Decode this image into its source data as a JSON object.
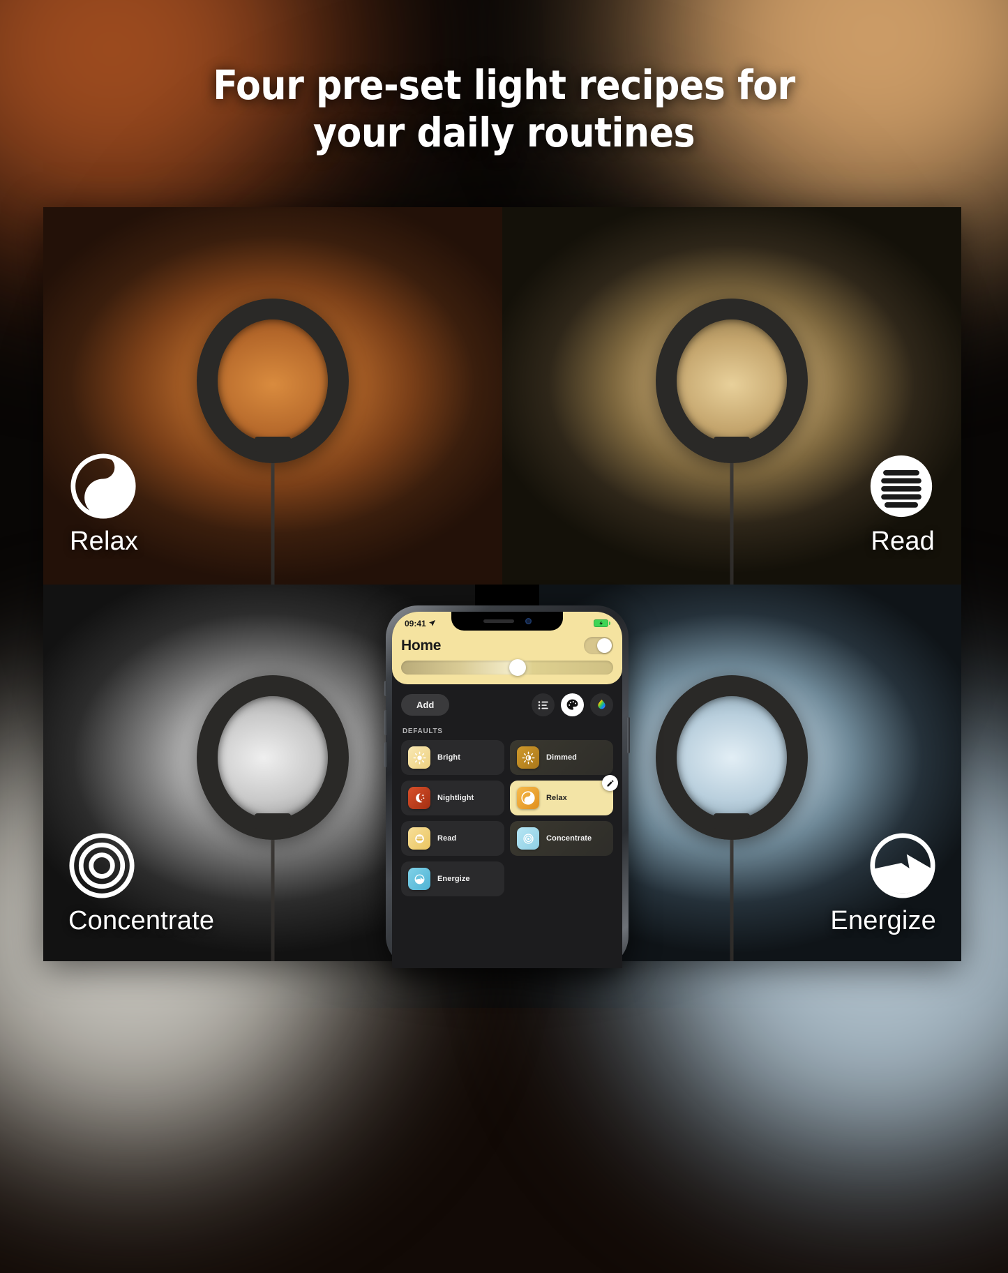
{
  "headline": {
    "line1": "Four pre-set light recipes for",
    "line2": "your daily routines"
  },
  "quadrants": [
    {
      "key": "relax",
      "label": "Relax",
      "icon": "relax-yinyang-icon",
      "glow_color": "#d98b3e"
    },
    {
      "key": "read",
      "label": "Read",
      "icon": "read-lines-icon",
      "glow_color": "#e8d09a"
    },
    {
      "key": "concentrate",
      "label": "Concentrate",
      "icon": "concentrate-rings-icon",
      "glow_color": "#efefef"
    },
    {
      "key": "energize",
      "label": "Energize",
      "icon": "energize-bolt-icon",
      "glow_color": "#e2eef5"
    }
  ],
  "phone": {
    "status_bar": {
      "time": "09:41",
      "location_icon": "location-arrow-icon",
      "battery_icon": "battery-charging-icon",
      "battery_color": "#3fd455"
    },
    "header": {
      "title": "Home",
      "power_toggle": {
        "name": "power-toggle",
        "state": "on"
      },
      "brightness_slider": {
        "name": "brightness-slider",
        "value_percent": 55
      },
      "card_color": "#f5e3a0"
    },
    "toolbar": {
      "add_label": "Add",
      "buttons": [
        {
          "name": "list-view-icon",
          "selected": false
        },
        {
          "name": "palette-icon",
          "selected": true
        },
        {
          "name": "color-drop-icon",
          "selected": false
        }
      ]
    },
    "scenes_section_label": "DEFAULTS",
    "scenes": [
      {
        "name": "Bright",
        "icon": "sun-icon",
        "icon_bg": "#f4dc93",
        "tile": "normal",
        "edit": false
      },
      {
        "name": "Dimmed",
        "icon": "sun-half-icon",
        "icon_bg": "#c08a22",
        "tile": "dim",
        "edit": false
      },
      {
        "name": "Nightlight",
        "icon": "moon-stars-icon",
        "icon_bg": "#c0391a",
        "tile": "normal",
        "edit": false
      },
      {
        "name": "Relax",
        "icon": "relax-yinyang-icon",
        "icon_bg": "#f0a93c",
        "tile": "active",
        "edit": true
      },
      {
        "name": "Read",
        "icon": "read-lines-icon",
        "icon_bg": "#f5d98c",
        "tile": "normal",
        "edit": false
      },
      {
        "name": "Concentrate",
        "icon": "rings-icon",
        "icon_bg": "#a7dcea",
        "tile": "dim",
        "edit": false
      },
      {
        "name": "Energize",
        "icon": "energize-bolt-icon",
        "icon_bg": "#6ec6e0",
        "tile": "normal",
        "edit": false
      }
    ],
    "edit_badge_icon": "pencil-icon"
  }
}
